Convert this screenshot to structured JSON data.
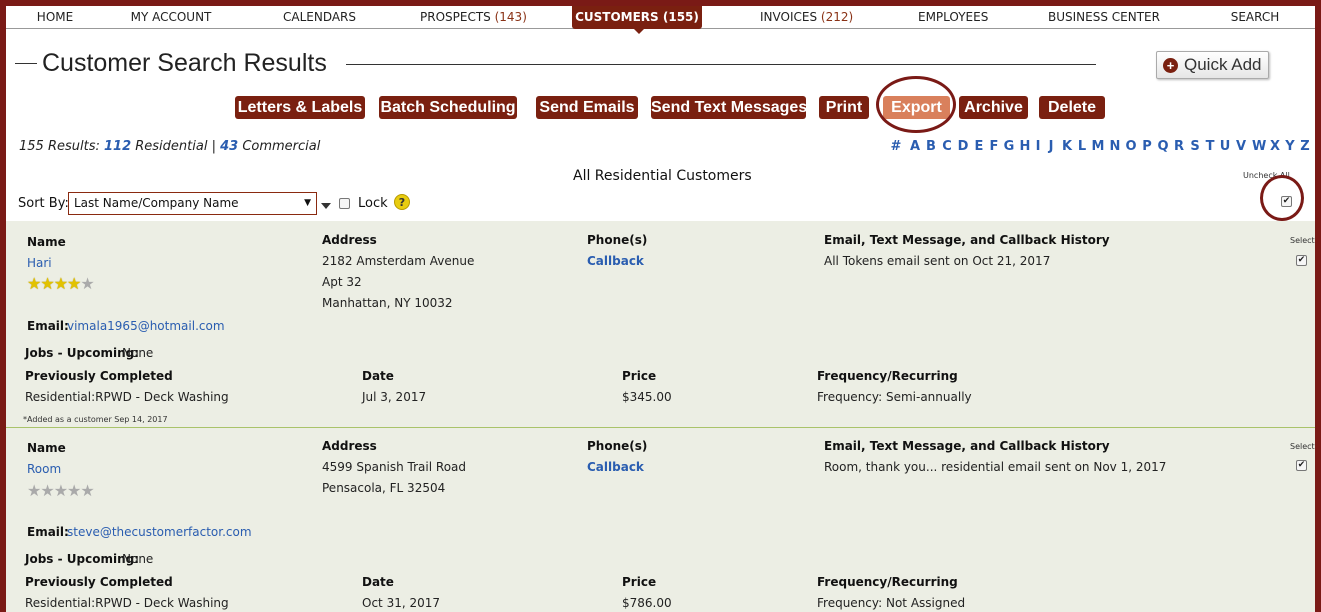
{
  "nav": {
    "items": [
      {
        "label": "HOME",
        "count": ""
      },
      {
        "label": "MY ACCOUNT",
        "count": ""
      },
      {
        "label": "CALENDARS",
        "count": ""
      },
      {
        "label": "PROSPECTS",
        "count": "(143)"
      },
      {
        "label": "CUSTOMERS",
        "count": "(155)"
      },
      {
        "label": "INVOICES",
        "count": "(212)"
      },
      {
        "label": "EMPLOYEES",
        "count": ""
      },
      {
        "label": "BUSINESS CENTER",
        "count": ""
      },
      {
        "label": "SEARCH",
        "count": ""
      }
    ],
    "active": "CUSTOMERS"
  },
  "page": {
    "title": "Customer Search Results",
    "quick_add": "Quick Add"
  },
  "actions": [
    "Letters & Labels",
    "Batch Scheduling",
    "Send Emails",
    "Send Text Messages",
    "Print",
    "Export",
    "Archive",
    "Delete"
  ],
  "results": {
    "prefix": "155 Results: ",
    "residential_count": "112",
    "residential_label": " Residential | ",
    "commercial_count": "43",
    "commercial_label": " Commercial"
  },
  "alphabet": [
    "#",
    "A",
    "B",
    "C",
    "D",
    "E",
    "F",
    "G",
    "H",
    "I",
    "J",
    "K",
    "L",
    "M",
    "N",
    "O",
    "P",
    "Q",
    "R",
    "S",
    "T",
    "U",
    "V",
    "W",
    "X",
    "Y",
    "Z"
  ],
  "section_title": "All Residential Customers",
  "uncheck_all": "Uncheck All",
  "sort": {
    "label": "Sort By:",
    "value": "Last Name/Company Name",
    "lock_label": "Lock",
    "help": "?"
  },
  "headers": {
    "name": "Name",
    "address": "Address",
    "phones": "Phone(s)",
    "history": "Email, Text Message, and Callback History",
    "select": "Select",
    "email": "Email:",
    "jobs_upcoming": "Jobs - Upcoming:",
    "prev_completed": "Previously Completed",
    "date": "Date",
    "price": "Price",
    "frequency": "Frequency/Recurring"
  },
  "customers": [
    {
      "name": "Hari",
      "rating": 4,
      "address": [
        "2182 Amsterdam Avenue",
        "Apt 32",
        "Manhattan, NY 10032"
      ],
      "phone": "Callback",
      "history": "All Tokens email sent on Oct 21, 2017",
      "email": "vimala1965@hotmail.com",
      "jobs_upcoming": "None",
      "prev_service": "Residential:RPWD - Deck Washing",
      "prev_date": "Jul 3, 2017",
      "prev_price": "$345.00",
      "frequency": "Frequency: Semi-annually",
      "added": "*Added as a customer Sep 14, 2017",
      "selected": true
    },
    {
      "name": "Room",
      "rating": 0,
      "address": [
        "4599 Spanish Trail Road",
        "Pensacola, FL 32504"
      ],
      "phone": "Callback",
      "history": "Room, thank you... residential email sent on Nov 1, 2017",
      "email": "steve@thecustomerfactor.com",
      "jobs_upcoming": "None",
      "prev_service": "Residential:RPWD - Deck Washing",
      "prev_date": "Oct 31, 2017",
      "prev_price": "$786.00",
      "frequency": "Frequency: Not Assigned",
      "selected": true
    }
  ],
  "icons": {
    "plus": "plus-circle-icon",
    "help": "question-icon",
    "star": "star-icon",
    "checkbox": "checkbox-icon"
  },
  "colors": {
    "brand": "#7a2010",
    "export": "#d9805c",
    "link": "#2a5db0",
    "row_bg": "#eceee4",
    "star": "#e2c200"
  }
}
